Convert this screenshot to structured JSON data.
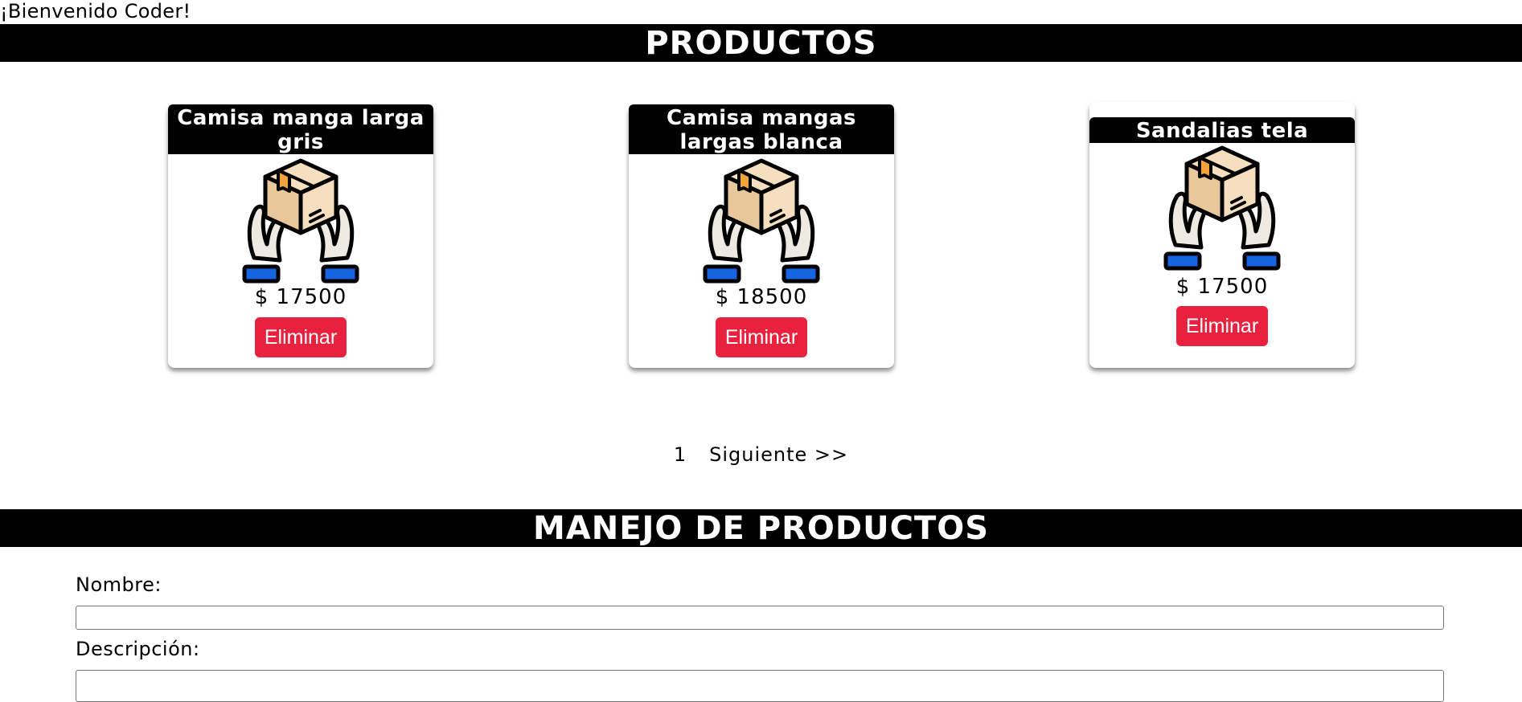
{
  "welcome": "¡Bienvenido Coder!",
  "products_section": {
    "title": "PRODUCTOS"
  },
  "products": [
    {
      "name": "Camisa manga larga gris",
      "price": "$ 17500",
      "delete_label": "Eliminar"
    },
    {
      "name": "Camisa mangas largas blanca",
      "price": "$ 18500",
      "delete_label": "Eliminar"
    },
    {
      "name": "Sandalias tela",
      "price": "$ 17500",
      "delete_label": "Eliminar"
    }
  ],
  "pagination": {
    "current_page": "1",
    "next_label": "Siguiente >>"
  },
  "management_section": {
    "title": "MANEJO DE PRODUCTOS"
  },
  "form": {
    "name_label": "Nombre:",
    "name_value": "",
    "description_label": "Descripción:",
    "description_value": ""
  },
  "colors": {
    "delete_button": "#e8213f",
    "header_bar": "#000000"
  },
  "icons": {
    "product_image": "hands-holding-box-icon"
  }
}
